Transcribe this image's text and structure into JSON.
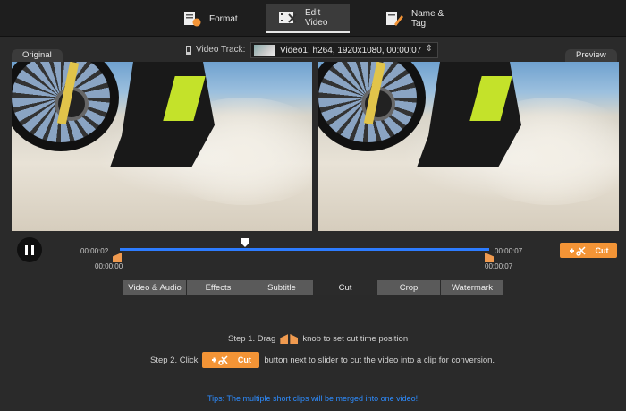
{
  "toolbar": {
    "tabs": [
      {
        "label": "Format",
        "icon": "format-icon"
      },
      {
        "label": "Edit Video",
        "icon": "edit-video-icon",
        "active": true
      },
      {
        "label": "Name & Tag",
        "icon": "name-tag-icon"
      }
    ]
  },
  "track": {
    "label": "Video Track:",
    "value": "Video1: h264, 1920x1080, 00:00:07"
  },
  "panes": {
    "original_label": "Original",
    "preview_label": "Preview"
  },
  "timeline": {
    "start_top": "00:00:02",
    "start_bottom": "00:00:00",
    "end_top": "00:00:07",
    "end_bottom": "00:00:07",
    "accent": "#2d7cff",
    "knob_color": "#f09a4f"
  },
  "cut_button": {
    "label": "Cut",
    "color": "#f39436"
  },
  "edit_tabs": [
    {
      "label": "Video & Audio"
    },
    {
      "label": "Effects"
    },
    {
      "label": "Subtitle"
    },
    {
      "label": "Cut",
      "active": true
    },
    {
      "label": "Crop"
    },
    {
      "label": "Watermark"
    }
  ],
  "instructions": {
    "step1_prefix": "Step 1. Drag",
    "step1_suffix": "knob to set cut time position",
    "step2_prefix": "Step 2. Click",
    "step2_button": "Cut",
    "step2_suffix": "button next to slider to cut the video into a clip for conversion.",
    "tip": "Tips: The multiple short clips will be merged into one video!!"
  }
}
